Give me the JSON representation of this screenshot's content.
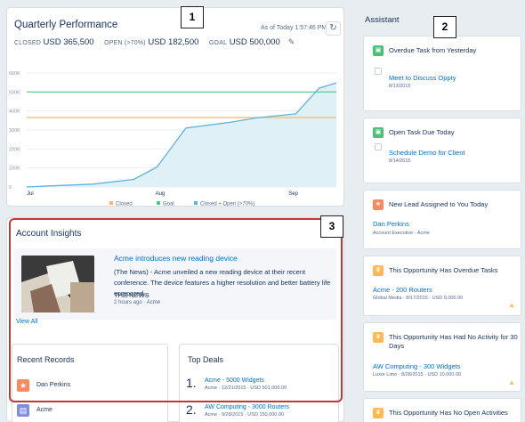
{
  "colors": {
    "orange": "#ffb75d",
    "green": "#4bca81",
    "teal": "#5eb4e2",
    "fill": "#dff0f7",
    "link": "#0070d2",
    "callout_border": "#c23934"
  },
  "quarterly": {
    "title": "Quarterly Performance",
    "as_of": "As of Today 1:57:46 PM",
    "refresh_icon": "refresh-icon",
    "closed_label": "CLOSED",
    "closed_value": "USD 365,500",
    "open_label": "OPEN (>70%)",
    "open_value": "USD 182,500",
    "goal_label": "GOAL",
    "goal_value": "USD 500,000",
    "edit_icon": "pencil-icon"
  },
  "chart_data": {
    "type": "line",
    "x_tick_labels": [
      "Jul",
      "Aug",
      "Sep"
    ],
    "y_tick_labels": [
      "0",
      "100K",
      "200K",
      "300K",
      "400K",
      "500K",
      "600K"
    ],
    "ylim": [
      0,
      600000
    ],
    "grid": true,
    "legend_position": "bottom",
    "series": [
      {
        "name": "Closed",
        "color": "#ffb75d",
        "values": [
          [
            0,
            365500
          ],
          [
            92,
            365500
          ]
        ]
      },
      {
        "name": "Goal",
        "color": "#4bca81",
        "values": [
          [
            0,
            500000
          ],
          [
            92,
            500000
          ]
        ]
      },
      {
        "name": "Closed + Open (>70%)",
        "color": "#5eb4e2",
        "area": true,
        "values": [
          [
            0,
            0
          ],
          [
            7,
            5000
          ],
          [
            23,
            15000
          ],
          [
            37,
            40000
          ],
          [
            45,
            105000
          ],
          [
            55,
            310000
          ],
          [
            70,
            340000
          ],
          [
            80,
            365000
          ],
          [
            93,
            385000
          ],
          [
            101,
            520000
          ],
          [
            107,
            548000
          ]
        ]
      }
    ]
  },
  "insights": {
    "title": "Account Insights",
    "headline": "Acme introduces new reading device",
    "body": "(The News) - Acme unveiled a new reading device at their recent conference. The device features a higher resolution and better battery life compared...",
    "source": "THE NEWS",
    "time": "2 hours ago · Acme",
    "view_all": "View All"
  },
  "recent": {
    "title": "Recent Records",
    "items": [
      {
        "label": "Dan Perkins",
        "icon": "lead-icon",
        "color": "#f88962"
      },
      {
        "label": "Acme",
        "icon": "account-icon",
        "color": "#7f8de1"
      }
    ]
  },
  "deals": {
    "title": "Top Deals",
    "items": [
      {
        "num": "1.",
        "name": "Acme - 5000 Widgets",
        "meta": "Acme · 12/21/2015 · USD 501,000.00"
      },
      {
        "num": "2.",
        "name": "AW Computing - 3000 Routers",
        "meta": "Acme · 9/28/2015 · USD 150,000.00"
      }
    ]
  },
  "assistant": {
    "title": "Assistant",
    "cards": [
      {
        "heading": "Overdue Task from Yesterday",
        "link": "Meet to Discuss Oppty",
        "sub": "8/13/2015",
        "icon": "task-icon",
        "color": "#4bc076"
      },
      {
        "heading": "Open Task Due Today",
        "link": "Schedule Demo for Client",
        "sub": "8/14/2015",
        "icon": "task-icon",
        "color": "#4bc076"
      },
      {
        "heading": "New Lead Assigned to You Today",
        "link": "Dan Perkins",
        "sub": "Account Executive · Acme",
        "icon": "lead-icon",
        "color": "#f88962"
      },
      {
        "heading": "This Opportunity Has Overdue Tasks",
        "link": "Acme - 200 Routers",
        "sub": "Global Media · 8/17/2015 · USD 9,000.00",
        "icon": "opportunity-icon",
        "color": "#fcb95b"
      },
      {
        "heading": "This Opportunity Has Had No Activity for 30 Days",
        "link": "AW Computing - 300 Widgets",
        "sub": "Luxor Limo · 8/28/2015 · USD 10,000.00",
        "icon": "opportunity-icon",
        "color": "#fcb95b"
      },
      {
        "heading": "This Opportunity Has No Open Activities",
        "icon": "opportunity-icon",
        "color": "#fcb95b"
      }
    ]
  },
  "callouts": [
    "1",
    "2",
    "3"
  ]
}
